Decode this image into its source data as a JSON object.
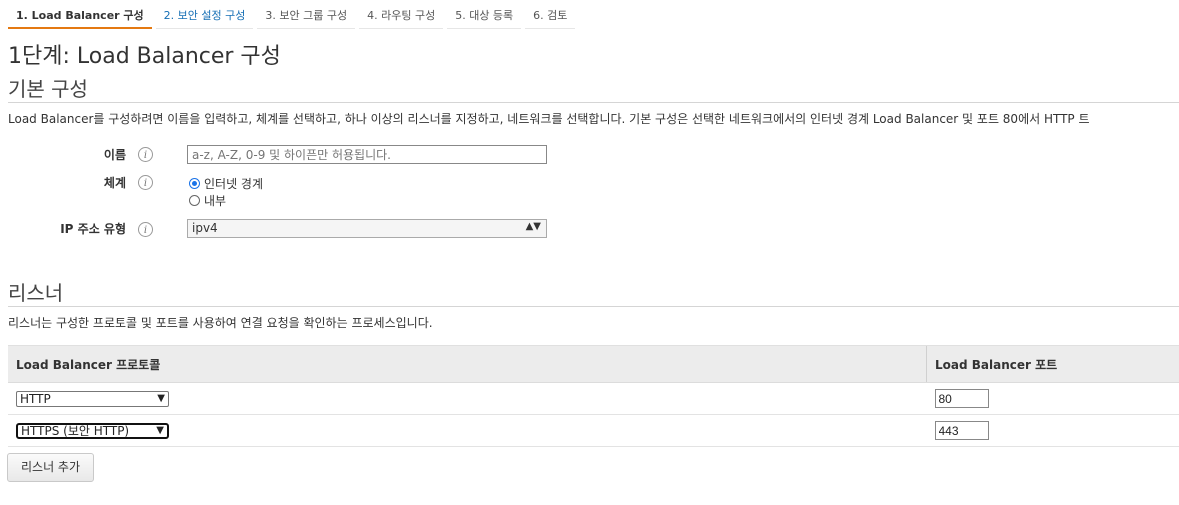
{
  "wizard_tabs": [
    {
      "label": "1. Load Balancer 구성"
    },
    {
      "label": "2. 보안 설정 구성"
    },
    {
      "label": "3. 보안 그룹 구성"
    },
    {
      "label": "4. 라우팅 구성"
    },
    {
      "label": "5. 대상 등록"
    },
    {
      "label": "6. 검토"
    }
  ],
  "page_title": "1단계: Load Balancer 구성",
  "basic": {
    "heading": "기본 구성",
    "description": "Load Balancer를 구성하려면 이름을 입력하고, 체계를 선택하고, 하나 이상의 리스너를 지정하고, 네트워크를 선택합니다. 기본 구성은 선택한 네트워크에서의 인터넷 경계 Load Balancer 및 포트 80에서 HTTP 트",
    "name_label": "이름",
    "name_placeholder": "a-z, A-Z, 0-9 및 하이픈만 허용됩니다.",
    "scheme_label": "체계",
    "scheme_options": [
      "인터넷 경계",
      "내부"
    ],
    "scheme_selected": "인터넷 경계",
    "ip_label": "IP 주소 유형",
    "ip_value": "ipv4",
    "info_icon_glyph": "i"
  },
  "listeners": {
    "heading": "리스너",
    "description": "리스너는 구성한 프로토콜 및 포트를 사용하여 연결 요청을 확인하는 프로세스입니다.",
    "col_protocol": "Load Balancer 프로토콜",
    "col_port": "Load Balancer 포트",
    "rows": [
      {
        "protocol": "HTTP",
        "port": "80"
      },
      {
        "protocol": "HTTPS (보안 HTTP)",
        "port": "443"
      }
    ],
    "add_button": "리스너 추가"
  }
}
